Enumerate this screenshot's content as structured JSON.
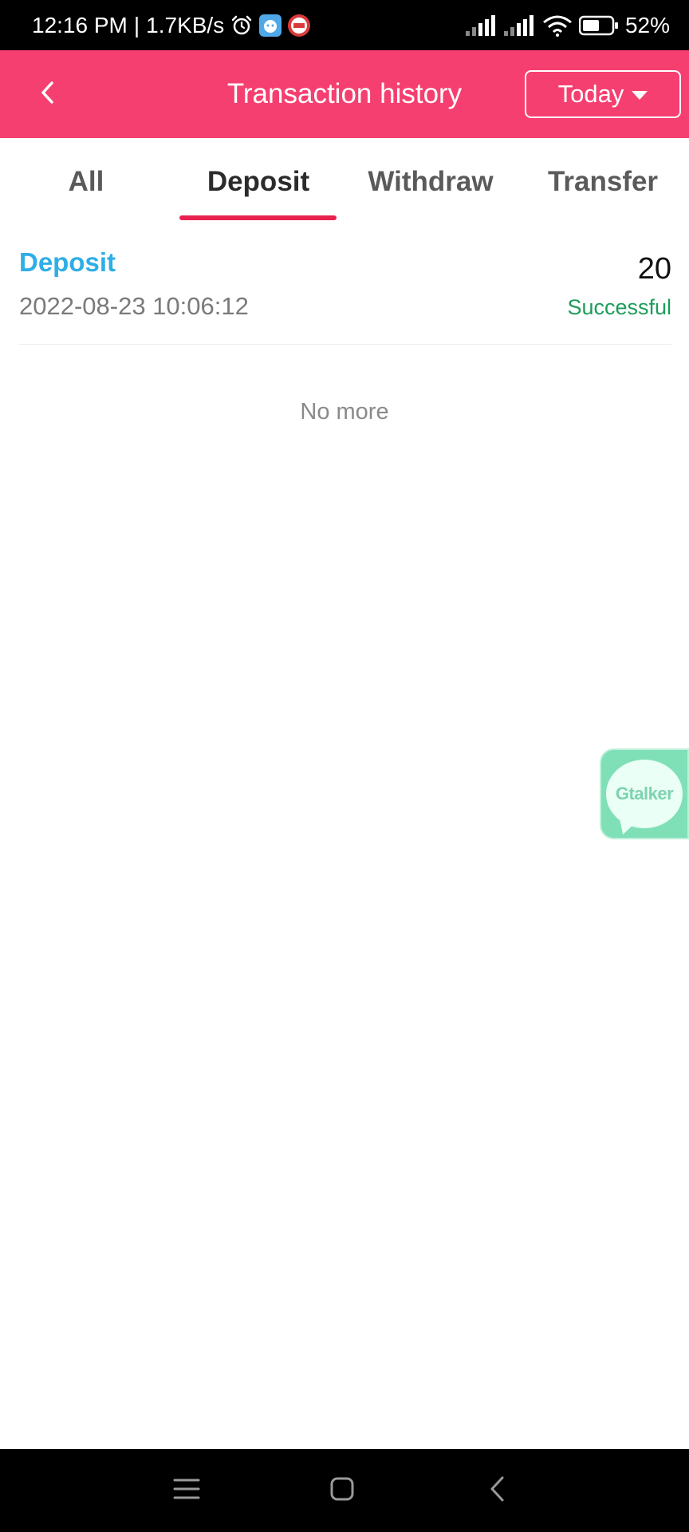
{
  "status_bar": {
    "time": "12:16 PM",
    "separator": "|",
    "network_speed": "1.7KB/s",
    "app_badge_1": "",
    "app_badge_2": "",
    "battery": "52%"
  },
  "app_bar": {
    "title": "Transaction history",
    "filter_label": "Today",
    "back_icon": "chevron-left-icon",
    "filter_icon": "caret-down-icon"
  },
  "tabs": [
    {
      "label": "All",
      "active": false
    },
    {
      "label": "Deposit",
      "active": true
    },
    {
      "label": "Withdraw",
      "active": false
    },
    {
      "label": "Transfer",
      "active": false
    }
  ],
  "transactions": [
    {
      "type": "Deposit",
      "datetime": "2022-08-23 10:06:12",
      "amount": "20",
      "status": "Successful"
    }
  ],
  "list_footer": "No more",
  "chat_fab": {
    "label": "Gtalker"
  },
  "colors": {
    "header": "#f53f70",
    "tab_indicator": "#e8224f",
    "type_text": "#2eaee6",
    "status_success": "#1e9c5b",
    "chat_fab": "#7fe0b8"
  }
}
